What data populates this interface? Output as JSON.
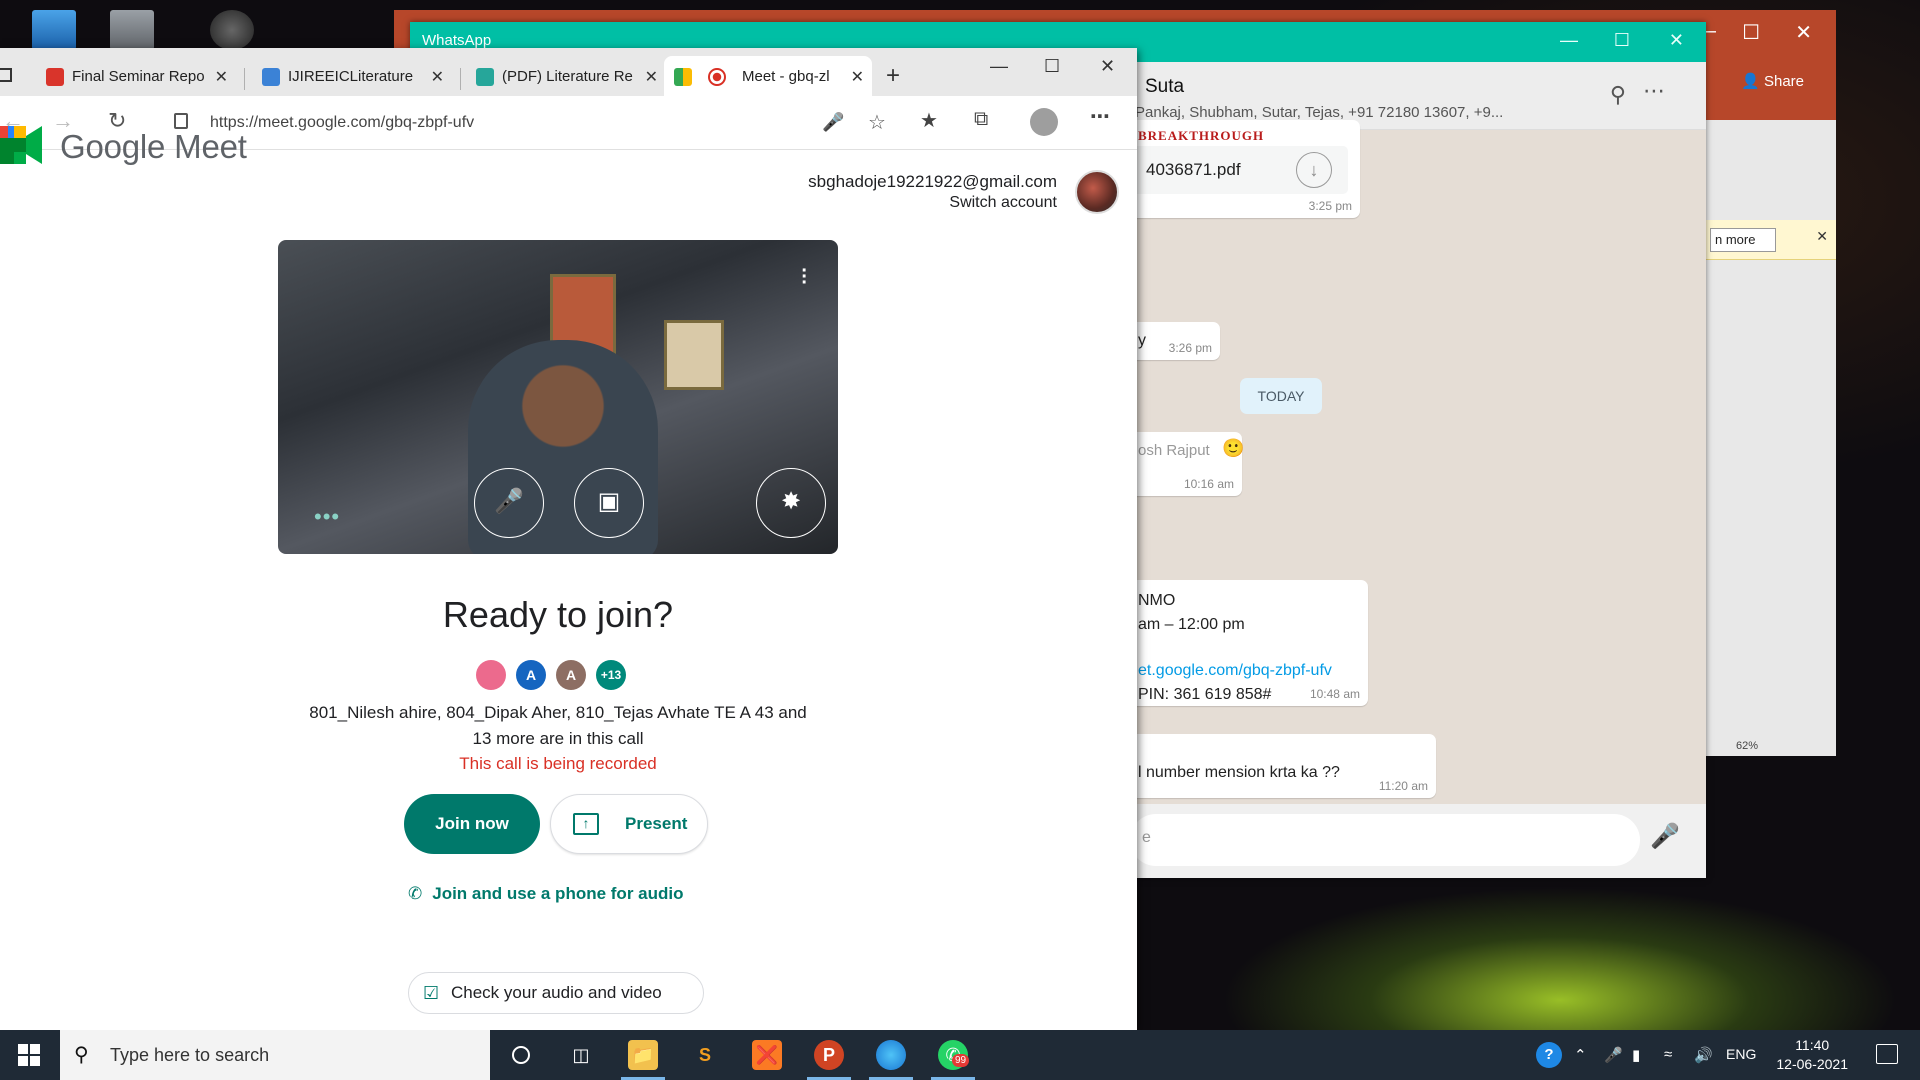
{
  "whatsapp": {
    "title": "WhatsApp",
    "chat_name": "Suta",
    "members": "Pankaj, Shubham, Sutar, Tejas, +91 72180 13607, +9...",
    "pdf_name": "4036871.pdf",
    "pdf_time": "3:25 pm",
    "msg1_text": "y",
    "msg1_time": "3:26 pm",
    "date_divider": "TODAY",
    "msg2_sender": "osh Rajput",
    "msg2_time": "10:16 am",
    "msg3_line1": "NMO",
    "msg3_line2": "am – 12:00 pm",
    "msg3_link": "et.google.com/gbq-zbpf-ufv",
    "msg3_pin": "PIN: 361 619 858#",
    "msg3_time": "10:48 am",
    "msg4_text": "l number mension krta ka ??",
    "msg4_time": "11:20 am",
    "input_placeholder": "e",
    "banner_text": "BREAKTHROUGH"
  },
  "powerpoint": {
    "share_label": "Share",
    "learn_more": "n more",
    "zoom": "62%"
  },
  "browser": {
    "tabs": [
      {
        "label": "Final Seminar Repo",
        "color": "#d9342b"
      },
      {
        "label": "IJIREEICLiterature",
        "color": "#3b82d6"
      },
      {
        "label": "(PDF) Literature Re",
        "color": "#26a69a"
      },
      {
        "label": "Meet - gbq-zl",
        "color": "#00897b"
      }
    ],
    "url": "https://meet.google.com/gbq-zbpf-ufv"
  },
  "meet": {
    "brand": "Google Meet",
    "email": "sbghadoje19221922@gmail.com",
    "switch_account": "Switch account",
    "ready_title": "Ready to join?",
    "avatars": [
      {
        "text": "",
        "color": "#ec6a8d"
      },
      {
        "text": "A",
        "color": "#1565c0"
      },
      {
        "text": "A",
        "color": "#8d6e63"
      },
      {
        "text": "+13",
        "color": "#00897b"
      }
    ],
    "in_call_line1": "801_Nilesh ahire, 804_Dipak Aher, 810_Tejas Avhate TE A 43 and",
    "in_call_line2": "13 more are in this call",
    "recorded": "This call is being recorded",
    "join_label": "Join now",
    "present_label": "Present",
    "phone_label": "Join and use a phone for audio",
    "check_label": "Check your audio and video"
  },
  "taskbar": {
    "search_placeholder": "Type here to search",
    "lang": "ENG",
    "time": "11:40",
    "date": "12-06-2021",
    "whatsapp_badge": "99"
  }
}
